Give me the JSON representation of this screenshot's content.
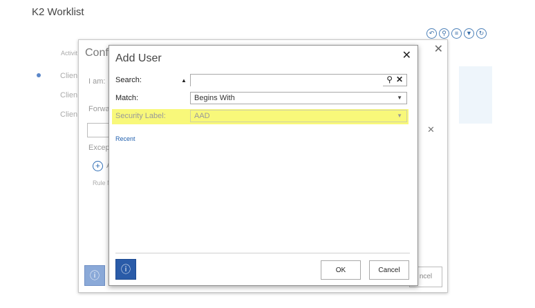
{
  "app": {
    "title": "K2 Worklist"
  },
  "toolbar": {
    "icons": [
      "back-icon",
      "search-icon",
      "list-icon",
      "filter-icon",
      "refresh-icon"
    ]
  },
  "background_list": {
    "column_header": "Activit",
    "rows": [
      "Clien",
      "Clien",
      "Clien"
    ]
  },
  "configure_dialog": {
    "title": "Confi",
    "i_am_label": "I am:",
    "forward_label": "Forwa",
    "except_label": "Except",
    "add_label": "A",
    "rule_label": "Rule N",
    "cancel_label": "ncel"
  },
  "add_user_dialog": {
    "title": "Add User",
    "search": {
      "label": "Search:",
      "value": "",
      "placeholder": ""
    },
    "match": {
      "label": "Match:",
      "value": "Begins With"
    },
    "security_label": {
      "label": "Security Label:",
      "value": "AAD"
    },
    "recent_link": "Recent",
    "ok_label": "OK",
    "cancel_label": "Cancel",
    "highlight_color": "#f8f87a"
  }
}
